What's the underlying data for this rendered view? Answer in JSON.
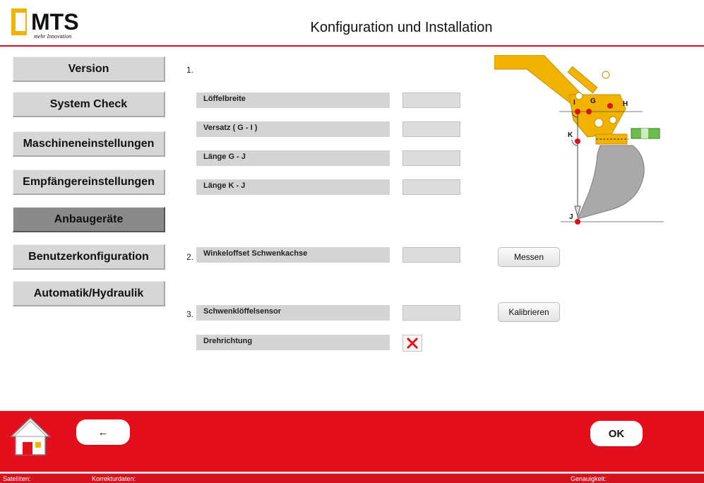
{
  "header": {
    "logo_text": "MTS",
    "logo_tagline": "mehr Innovation",
    "title": "Konfiguration und Installation"
  },
  "sidebar": {
    "items": [
      {
        "label": "Version"
      },
      {
        "label": "System Check"
      },
      {
        "label": "Maschineneinstellungen"
      },
      {
        "label": "Empfängereinstellungen"
      },
      {
        "label": "Anbaugeräte",
        "active": true
      },
      {
        "label": "Benutzerkonfiguration"
      },
      {
        "label": "Automatik/Hydraulik"
      }
    ]
  },
  "section1": {
    "number": "1.",
    "fields": [
      {
        "label": "Löffelbreite",
        "value": ""
      },
      {
        "label": "Versatz ( G - I )",
        "value": ""
      },
      {
        "label": "Länge G - J",
        "value": ""
      },
      {
        "label": "Länge K - J",
        "value": ""
      }
    ]
  },
  "section2": {
    "number": "2.",
    "label": "Winkeloffset Schwenkachse",
    "value": "",
    "button": "Messen"
  },
  "section3": {
    "number": "3.",
    "label": "Schwenklöffelsensor",
    "value": "",
    "button": "Kalibrieren",
    "direction_label": "Drehrichtung",
    "direction_checked": false
  },
  "diagram": {
    "points": [
      "I",
      "G",
      "H",
      "K",
      "J"
    ]
  },
  "footer": {
    "back_label": "←",
    "ok_label": "OK"
  },
  "statusbar": {
    "satellites": "Satelliten:",
    "correction": "Korrekturdaten:",
    "accuracy": "Genauigkeit:"
  },
  "colors": {
    "brand_red": "#e30f1c",
    "accent_yellow": "#f2b200"
  }
}
